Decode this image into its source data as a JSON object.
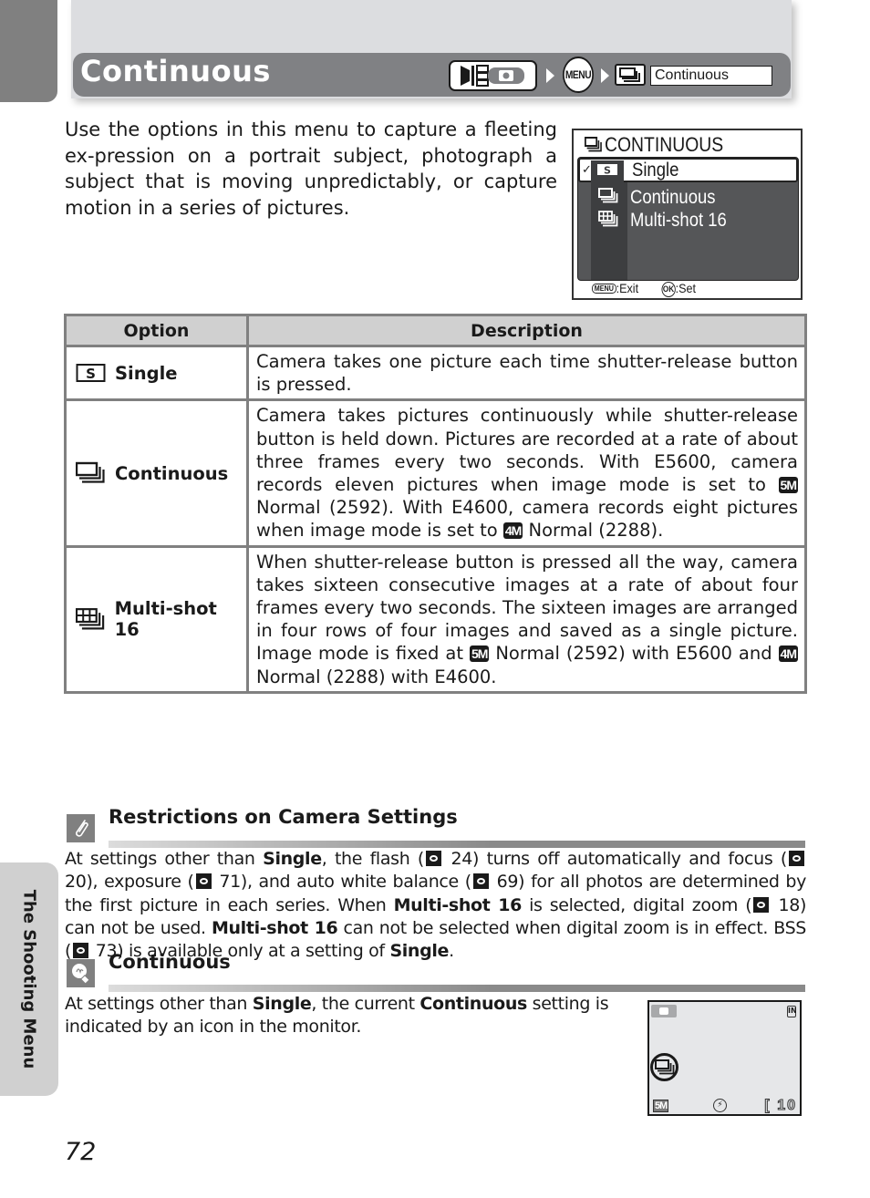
{
  "side_tab": {
    "label": "The Shooting Menu"
  },
  "header": {
    "title": "Continuous",
    "breadcrumb": {
      "mode_icon": "shooting-mode-camera-icon",
      "menu_button": "MENU",
      "setting_icon": "continuous-icon",
      "setting_label": "Continuous"
    }
  },
  "intro": "Use the options in this menu to capture a fleeting ex-pression on a portrait subject, photograph a subject that is moving unpredictably, or capture motion in a series of pictures.",
  "camera_menu": {
    "title": "CONTINUOUS",
    "items": [
      {
        "label": "Single",
        "icon": "single-icon",
        "selected": true
      },
      {
        "label": "Continuous",
        "icon": "continuous-icon",
        "selected": false
      },
      {
        "label": "Multi-shot 16",
        "icon": "multi-shot-16-icon",
        "selected": false
      }
    ],
    "footer": {
      "exit_key": "MENU",
      "exit_label": ":Exit",
      "set_key": "OK",
      "set_label": ":Set"
    }
  },
  "table": {
    "headers": {
      "option": "Option",
      "description": "Description"
    },
    "rows": [
      {
        "icon": "single-icon",
        "option": "Single",
        "desc_parts": [
          "Camera takes one picture each time shutter-release button is pressed."
        ]
      },
      {
        "icon": "continuous-icon",
        "option": "Continuous",
        "desc_parts": [
          "Camera takes pictures continuously while shutter-release button is held down. Pictures are recorded at a rate of about three frames every two seconds. With E5600, camera records eleven pictures when image mode is set to ",
          "5M",
          " Normal (2592). With E4600, camera records eight pictures when image mode is set to ",
          "4M",
          " Normal (2288)."
        ]
      },
      {
        "icon": "multi-shot-16-icon",
        "option": "Multi-shot 16",
        "desc_parts": [
          "When shutter-release button is pressed all the way, camera takes sixteen consecutive images at a rate of about four frames every two seconds. The sixteen images are arranged in four rows of four images and saved as a single picture. Image mode is fixed at ",
          "5M",
          " Normal (2592) with E5600 and ",
          "4M",
          " Normal (2288) with E4600."
        ]
      }
    ]
  },
  "notes": [
    {
      "icon": "paperclip-note-icon",
      "title": "Restrictions on Camera Settings",
      "body": [
        {
          "t": "At settings other than "
        },
        {
          "b": "Single"
        },
        {
          "t": ", the flash ("
        },
        {
          "ref": "24"
        },
        {
          "t": ") turns off automatically and focus ("
        },
        {
          "ref": "20"
        },
        {
          "t": "), exposure ("
        },
        {
          "ref": "71"
        },
        {
          "t": "), and auto white balance ("
        },
        {
          "ref": "69"
        },
        {
          "t": ") for all photos are determined by the first picture in each series. When "
        },
        {
          "b": "Multi-shot 16"
        },
        {
          "t": " is selected, digital zoom ("
        },
        {
          "ref": "18"
        },
        {
          "t": ") can not be used. "
        },
        {
          "b": "Multi-shot 16"
        },
        {
          "t": " can not be selected when digital zoom is in effect. BSS ("
        },
        {
          "ref": "73"
        },
        {
          "t": ") is available only at a setting of "
        },
        {
          "b": "Single"
        },
        {
          "t": "."
        }
      ]
    },
    {
      "icon": "lightbulb-tip-icon",
      "title": "Continuous",
      "body": [
        {
          "t": "At settings other than "
        },
        {
          "b": "Single"
        },
        {
          "t": ", the current "
        },
        {
          "b": "Continuous"
        },
        {
          "t": " setting is indicated by an icon in the monitor."
        }
      ]
    }
  ],
  "monitor": {
    "image_mode": "5M",
    "exposures_remaining": "10",
    "card_label": "IN",
    "flash_icon": "flash-off-icon"
  },
  "page_number": "72",
  "colors": {
    "banner": "#808184",
    "banner_bg": "#dcdde0",
    "table_border": "#808080",
    "table_header": "#d0d0d0",
    "lcd_panel": "#555658"
  }
}
